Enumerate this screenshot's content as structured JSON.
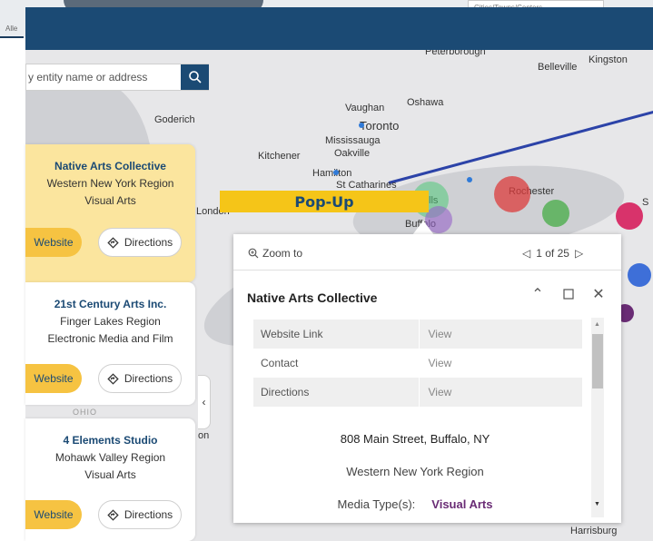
{
  "background": {
    "legend_text": "Cities/Towns/Centers",
    "left_label": "Alle"
  },
  "search": {
    "placeholder": "y entity name or address"
  },
  "map": {
    "cities": [
      "Peterborough",
      "Belleville",
      "Kingston",
      "Oshawa",
      "Vaughan",
      "Toronto",
      "Mississauga",
      "Oakville",
      "Kitchener",
      "Hamilton",
      "St Catharines",
      "Rochester",
      "Buffalo",
      "London",
      "Goderich",
      "Harrisburg",
      "lls",
      "on",
      "S",
      "OHIO"
    ]
  },
  "cards": [
    {
      "title": "Native Arts Collective",
      "region": "Western New York  Region",
      "media": "Visual Arts",
      "website_label": "Website",
      "directions_label": "Directions"
    },
    {
      "title": "21st Century Arts Inc.",
      "region": "Finger Lakes Region",
      "media": "Electronic Media and Film",
      "website_label": "Website",
      "directions_label": "Directions"
    },
    {
      "title": "4 Elements Studio",
      "region": "Mohawk Valley Region",
      "media": "Visual Arts",
      "website_label": "Website",
      "directions_label": "Directions"
    }
  ],
  "annotation": {
    "label": "Pop-Up"
  },
  "popup": {
    "zoom_label": "Zoom to",
    "pager": "1 of 25",
    "title": "Native Arts Collective",
    "rows": [
      {
        "field": "Website Link",
        "value": "View"
      },
      {
        "field": "Contact",
        "value": "View"
      },
      {
        "field": "Directions",
        "value": "View"
      }
    ],
    "address": "808 Main Street, Buffalo, NY",
    "region": "Western New York  Region",
    "media_label": "Media Type(s):",
    "media_value": "Visual Arts"
  },
  "colors": {
    "header": "#1b4a74",
    "card_active": "#fbe59e",
    "website_button": "#f6c342",
    "annotation": "#f5c518",
    "media_value": "#6a2c75"
  },
  "icons": [
    "search-icon",
    "directions-icon",
    "zoom-icon",
    "prev-arrow-icon",
    "next-arrow-icon",
    "collapse-icon",
    "maximize-icon",
    "close-icon",
    "collapse-panel-icon"
  ]
}
